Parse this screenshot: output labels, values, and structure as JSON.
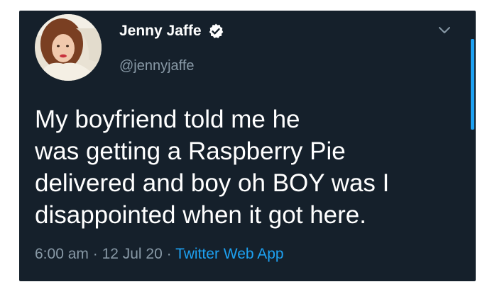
{
  "tweet": {
    "display_name": "Jenny Jaffe",
    "handle": "@jennyjaffe",
    "verified": true,
    "text": "My boyfriend told me he\nwas getting a Raspberry Pie\ndelivered and boy oh BOY was I\ndisappointed when it got here.",
    "time": "6:00 am",
    "date": "12 Jul 20",
    "separator": " · ",
    "source": "Twitter Web App"
  },
  "icons": {
    "verified": "verified-badge-icon",
    "menu": "chevron-down-icon"
  },
  "colors": {
    "background": "#15202b",
    "text": "#ffffff",
    "secondary": "#8899a6",
    "accent": "#1da1f2"
  }
}
